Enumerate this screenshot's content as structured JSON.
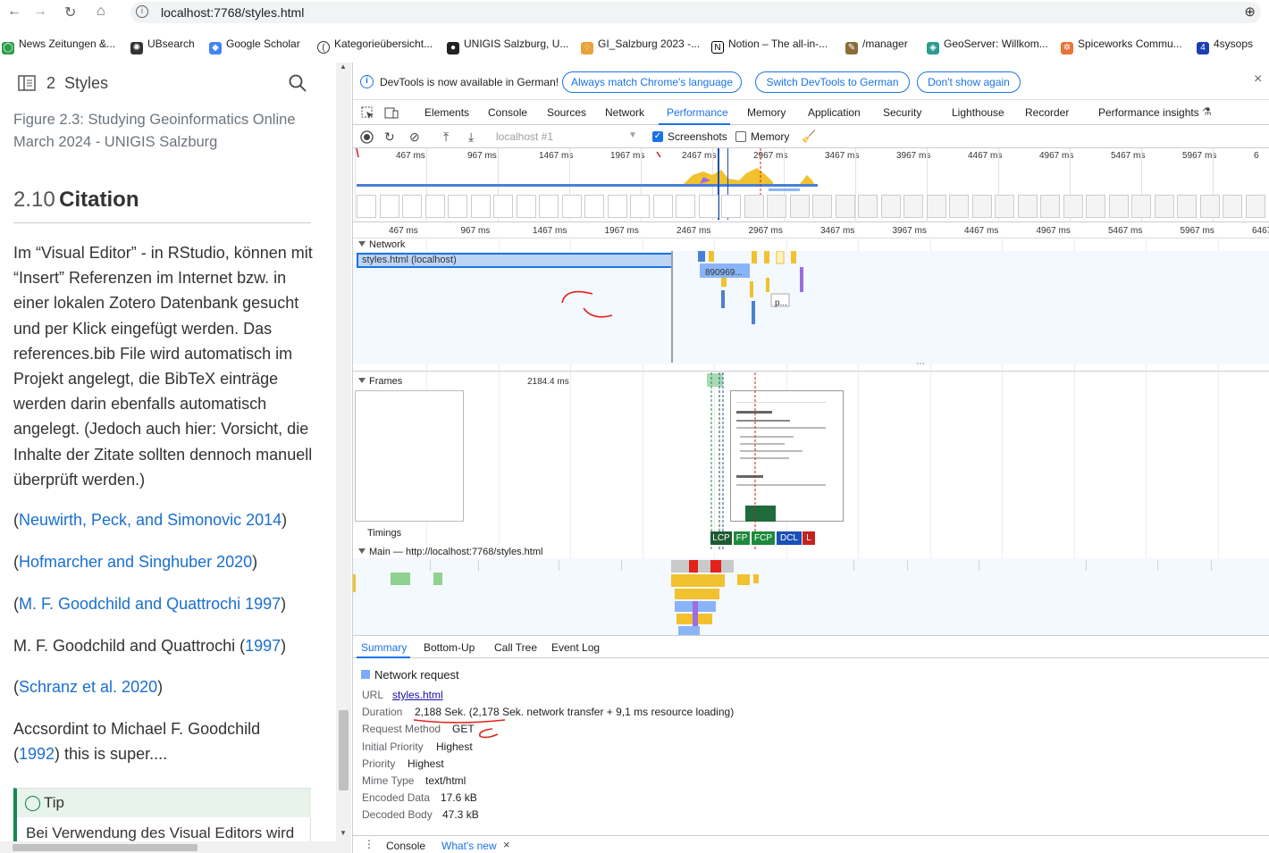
{
  "browser": {
    "url": "localhost:7768/styles.html",
    "bookmarks": [
      "News Zeitungen &...",
      "UBsearch",
      "Google Scholar",
      "Kategorieübersicht...",
      "UNIGIS Salzburg, U...",
      "GI_Salzburg 2023 -...",
      "Notion – The all-in-...",
      "/manager",
      "GeoServer: Willkom...",
      "Spiceworks Commu...",
      "4sysops"
    ]
  },
  "doc": {
    "chapter_num": "2",
    "chapter_title": "Styles",
    "figure_caption": "Figure 2.3: Studying Geoinformatics Online March 2024 - UNIGIS Salzburg",
    "section_num": "2.10",
    "section_title": "Citation",
    "paragraph": "Im “Visual Editor” - in RStudio, können mit “Insert” Referenzen im Internet bzw. in einer lokalen Zotero Datenbank gesucht und per Klick eingefügt werden. Das references.bib File wird automatisch im Projekt angelegt, die BibTeX einträge werden darin ebenfalls automatisch angelegt. (Jedoch auch hier: Vorsicht, die Inhalte der Zitate sollten dennoch manuell überprüft werden.)",
    "citations": [
      {
        "pre": "(",
        "link": "Neuwirth, Peck, and Simonovic 2014",
        "post": ")"
      },
      {
        "pre": "(",
        "link": "Hofmarcher and Singhuber 2020",
        "post": ")"
      },
      {
        "pre": "(",
        "link": "M. F. Goodchild and Quattrochi 1997",
        "post": ")"
      },
      {
        "pre": "M. F. Goodchild and Quattrochi (",
        "link": "1997",
        "post": ")"
      },
      {
        "pre": "(",
        "link": "Schranz et al. 2020",
        "post": ")"
      }
    ],
    "goodchild_line1": "Accsordint to Michael F. Goodchild",
    "goodchild_pre": "(",
    "goodchild_year": "1992",
    "goodchild_post": ") this is super....",
    "tip_title": "Tip",
    "tip_body": "Bei Verwendung des Visual Editors wird"
  },
  "devtools": {
    "info_message": "DevTools is now available in German!",
    "info_buttons": [
      "Always match Chrome's language",
      "Switch DevTools to German",
      "Don't show again"
    ],
    "tabs": [
      "Elements",
      "Console",
      "Sources",
      "Network",
      "Performance",
      "Memory",
      "Application",
      "Security",
      "Lighthouse",
      "Recorder",
      "Performance insights"
    ],
    "active_tab": "Performance",
    "perf_toolbar": {
      "target": "localhost #1",
      "screenshots_label": "Screenshots",
      "screenshots_checked": true,
      "memory_label": "Memory",
      "memory_checked": false
    },
    "overview_ticks": [
      "467 ms",
      "967 ms",
      "1467 ms",
      "1967 ms",
      "2467 ms",
      "2967 ms",
      "3467 ms",
      "3967 ms",
      "4467 ms",
      "4967 ms",
      "5467 ms",
      "5967 ms",
      "6"
    ],
    "ruler_ticks": [
      "467 ms",
      "967 ms",
      "1467 ms",
      "1967 ms",
      "2467 ms",
      "2967 ms",
      "3467 ms",
      "3967 ms",
      "4467 ms",
      "4967 ms",
      "5467 ms",
      "5967 ms",
      "6467"
    ],
    "tracks": {
      "network_label": "Network",
      "network_request": "styles.html (localhost)",
      "network_small": "890969...",
      "network_p": "p...",
      "frames_label": "Frames",
      "frames_time": "2184.4 ms",
      "timings_label": "Timings",
      "main_label": "Main — http://localhost:7768/styles.html"
    },
    "markers": [
      "LCP",
      "FP",
      "FCP",
      "DCL",
      "L"
    ],
    "marker_colors": [
      "#1e5a34",
      "#1e8a3c",
      "#1e8a3c",
      "#1a4fb5",
      "#c5221f"
    ],
    "summary_tabs": [
      "Summary",
      "Bottom-Up",
      "Call Tree",
      "Event Log"
    ],
    "summary": {
      "title": "Network request",
      "url_label": "URL",
      "url": "styles.html",
      "duration_label": "Duration",
      "duration": "2,188 Sek. (2,178 Sek. network transfer + 9,1 ms resource loading)",
      "method_label": "Request Method",
      "method": "GET",
      "initial_priority_label": "Initial Priority",
      "initial_priority": "Highest",
      "priority_label": "Priority",
      "priority": "Highest",
      "mime_label": "Mime Type",
      "mime": "text/html",
      "encoded_label": "Encoded Data",
      "encoded": "17.6 kB",
      "decoded_label": "Decoded Body",
      "decoded": "47.3 kB"
    },
    "drawer": {
      "console": "Console",
      "whats_new": "What's new"
    }
  }
}
